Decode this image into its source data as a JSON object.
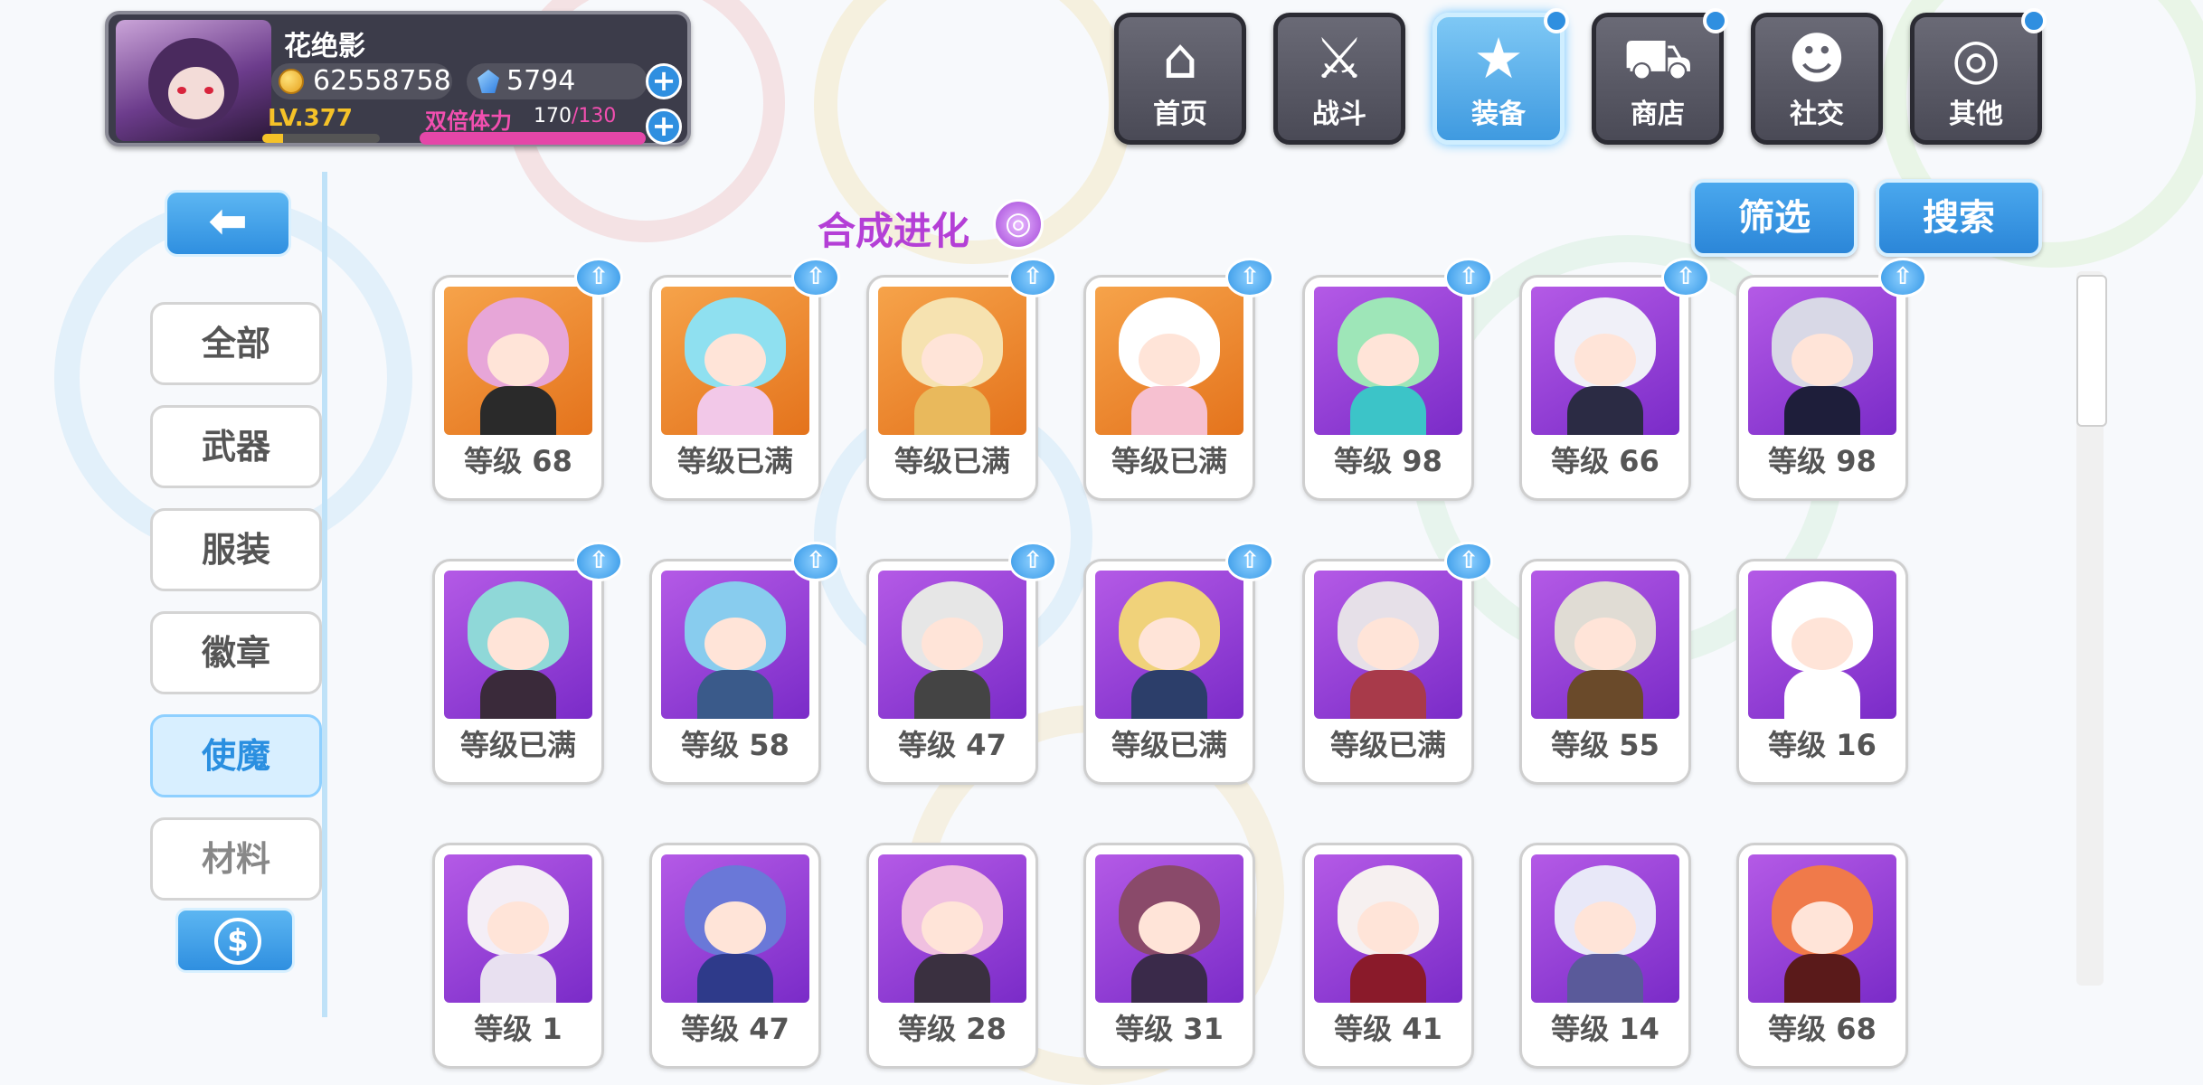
{
  "player": {
    "name": "花绝影",
    "gold": "62558758",
    "gems": "5794",
    "level": "LV.377",
    "level_progress": 0.18,
    "stamina_label": "双倍体力",
    "stamina_current": "170",
    "stamina_max": "/130",
    "stamina_progress": 1.0
  },
  "nav": [
    {
      "label": "首页",
      "icon": "house-icon",
      "active": false,
      "badge": false
    },
    {
      "label": "战斗",
      "icon": "crossed-swords-icon",
      "active": false,
      "badge": false
    },
    {
      "label": "装备",
      "icon": "star-gun-icon",
      "active": true,
      "badge": true
    },
    {
      "label": "商店",
      "icon": "shopping-cart-icon",
      "active": false,
      "badge": true
    },
    {
      "label": "社交",
      "icon": "ghost-face-icon",
      "active": false,
      "badge": false
    },
    {
      "label": "其他",
      "icon": "target-icon",
      "active": false,
      "badge": true
    }
  ],
  "sidebar": {
    "back_icon": "arrow-left-icon",
    "items": [
      {
        "label": "全部",
        "active": false
      },
      {
        "label": "武器",
        "active": false
      },
      {
        "label": "服装",
        "active": false
      },
      {
        "label": "徽章",
        "active": false
      },
      {
        "label": "使魔",
        "active": true
      },
      {
        "label": "材料",
        "active": false
      }
    ],
    "currency_icon": "dollar-coin-icon"
  },
  "section": {
    "title": "合成进化",
    "title_icon": "swirl-icon"
  },
  "actions": {
    "filter_label": "筛选",
    "search_label": "搜索"
  },
  "familiars": [
    {
      "level": "等级 68",
      "bg": "orange",
      "hair": "#e7a6d8",
      "body": "#2a2a2a",
      "evolve": true
    },
    {
      "level": "等级已满",
      "bg": "orange",
      "hair": "#8fe0f0",
      "body": "#f2c8e8",
      "evolve": true
    },
    {
      "level": "等级已满",
      "bg": "orange",
      "hair": "#f6e2b0",
      "body": "#e9b95c",
      "evolve": true
    },
    {
      "level": "等级已满",
      "bg": "orange",
      "hair": "#ffffff",
      "body": "#f6c0d0",
      "evolve": true
    },
    {
      "level": "等级 98",
      "bg": "purple",
      "hair": "#9ee6b8",
      "body": "#3cc4c8",
      "evolve": true
    },
    {
      "level": "等级 66",
      "bg": "purple",
      "hair": "#f0f0f8",
      "body": "#2b2b44",
      "evolve": true
    },
    {
      "level": "等级 98",
      "bg": "purple",
      "hair": "#d8d8e6",
      "body": "#1e1e3a",
      "evolve": true
    },
    {
      "level": "等级已满",
      "bg": "purple",
      "hair": "#8fd8d8",
      "body": "#3a2a3a",
      "evolve": true
    },
    {
      "level": "等级 58",
      "bg": "purple",
      "hair": "#88ccee",
      "body": "#3a5a8a",
      "evolve": true
    },
    {
      "level": "等级 47",
      "bg": "purple",
      "hair": "#e6e6e6",
      "body": "#444444",
      "evolve": true
    },
    {
      "level": "等级已满",
      "bg": "purple",
      "hair": "#f0d27a",
      "body": "#2c3e6a",
      "evolve": true
    },
    {
      "level": "等级已满",
      "bg": "purple",
      "hair": "#e6e0e8",
      "body": "#a83a4a",
      "evolve": true
    },
    {
      "level": "等级 55",
      "bg": "purple",
      "hair": "#e0dcd4",
      "body": "#6a4a2a",
      "evolve": false
    },
    {
      "level": "等级 16",
      "bg": "purple",
      "hair": "#ffffff",
      "body": "#ffffff",
      "evolve": false
    },
    {
      "level": "等级 1",
      "bg": "purple",
      "hair": "#f4eef6",
      "body": "#e8e0f0",
      "evolve": false
    },
    {
      "level": "等级 47",
      "bg": "purple",
      "hair": "#6a78d8",
      "body": "#2e3a8a",
      "evolve": false
    },
    {
      "level": "等级 28",
      "bg": "purple",
      "hair": "#f0c0e0",
      "body": "#3a3040",
      "evolve": false
    },
    {
      "level": "等级 31",
      "bg": "purple",
      "hair": "#8a4a6a",
      "body": "#3a2a4a",
      "evolve": false
    },
    {
      "level": "等级 41",
      "bg": "purple",
      "hair": "#f6f0f0",
      "body": "#8a1a2a",
      "evolve": false
    },
    {
      "level": "等级 14",
      "bg": "purple",
      "hair": "#e8e8f8",
      "body": "#5a5a9a",
      "evolve": false
    },
    {
      "level": "等级 68",
      "bg": "purple",
      "hair": "#f07a4a",
      "body": "#5a1a1a",
      "evolve": false
    }
  ]
}
